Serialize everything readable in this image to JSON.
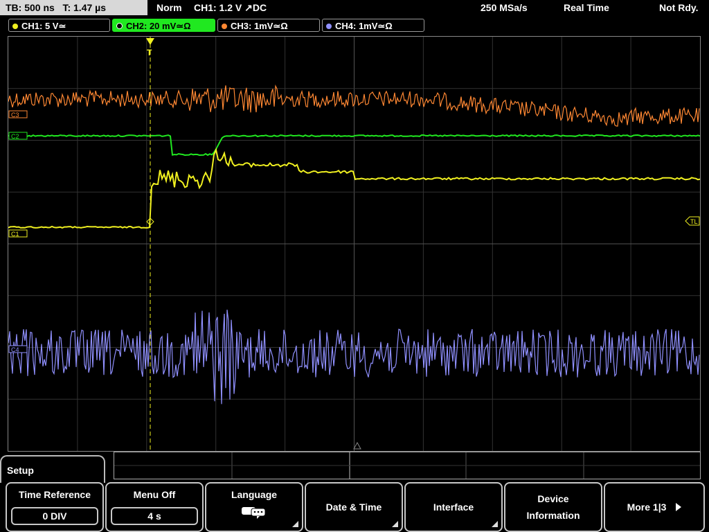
{
  "header": {
    "timebase": "TB: 500 ns   T: 1.47 µs",
    "trigger_mode": "Norm",
    "trigger_info": "CH1: 1.2 V ↗DC",
    "sample_rate": "250 MSa/s",
    "acq_mode": "Real Time",
    "status": "Not Rdy."
  },
  "channels": [
    {
      "label": "CH1: 5 V≃",
      "color": "#f0f020"
    },
    {
      "label": "CH2: 20 mV≃Ω",
      "color": "#20e820",
      "active": true
    },
    {
      "label": "CH3: 1mV≃Ω",
      "color": "#ff8833"
    },
    {
      "label": "CH4: 1mV≃Ω",
      "color": "#9090ff"
    }
  ],
  "markers": {
    "c1": "C1",
    "c2": "C2",
    "c3": "C3",
    "c4": "C4",
    "trigger_level": "TL",
    "trigger_pos": "T"
  },
  "menu": {
    "title": "Setup",
    "softkeys": [
      {
        "label": "Time Reference",
        "value": "0 DIV"
      },
      {
        "label": "Menu Off",
        "value": "4 s"
      },
      {
        "label": "Language",
        "icon": "speech-bubbles-icon"
      },
      {
        "label": "Date & Time"
      },
      {
        "label": "Interface"
      },
      {
        "label_line1": "Device",
        "label_line2": "Information"
      },
      {
        "label": "More 1|3"
      }
    ]
  }
}
